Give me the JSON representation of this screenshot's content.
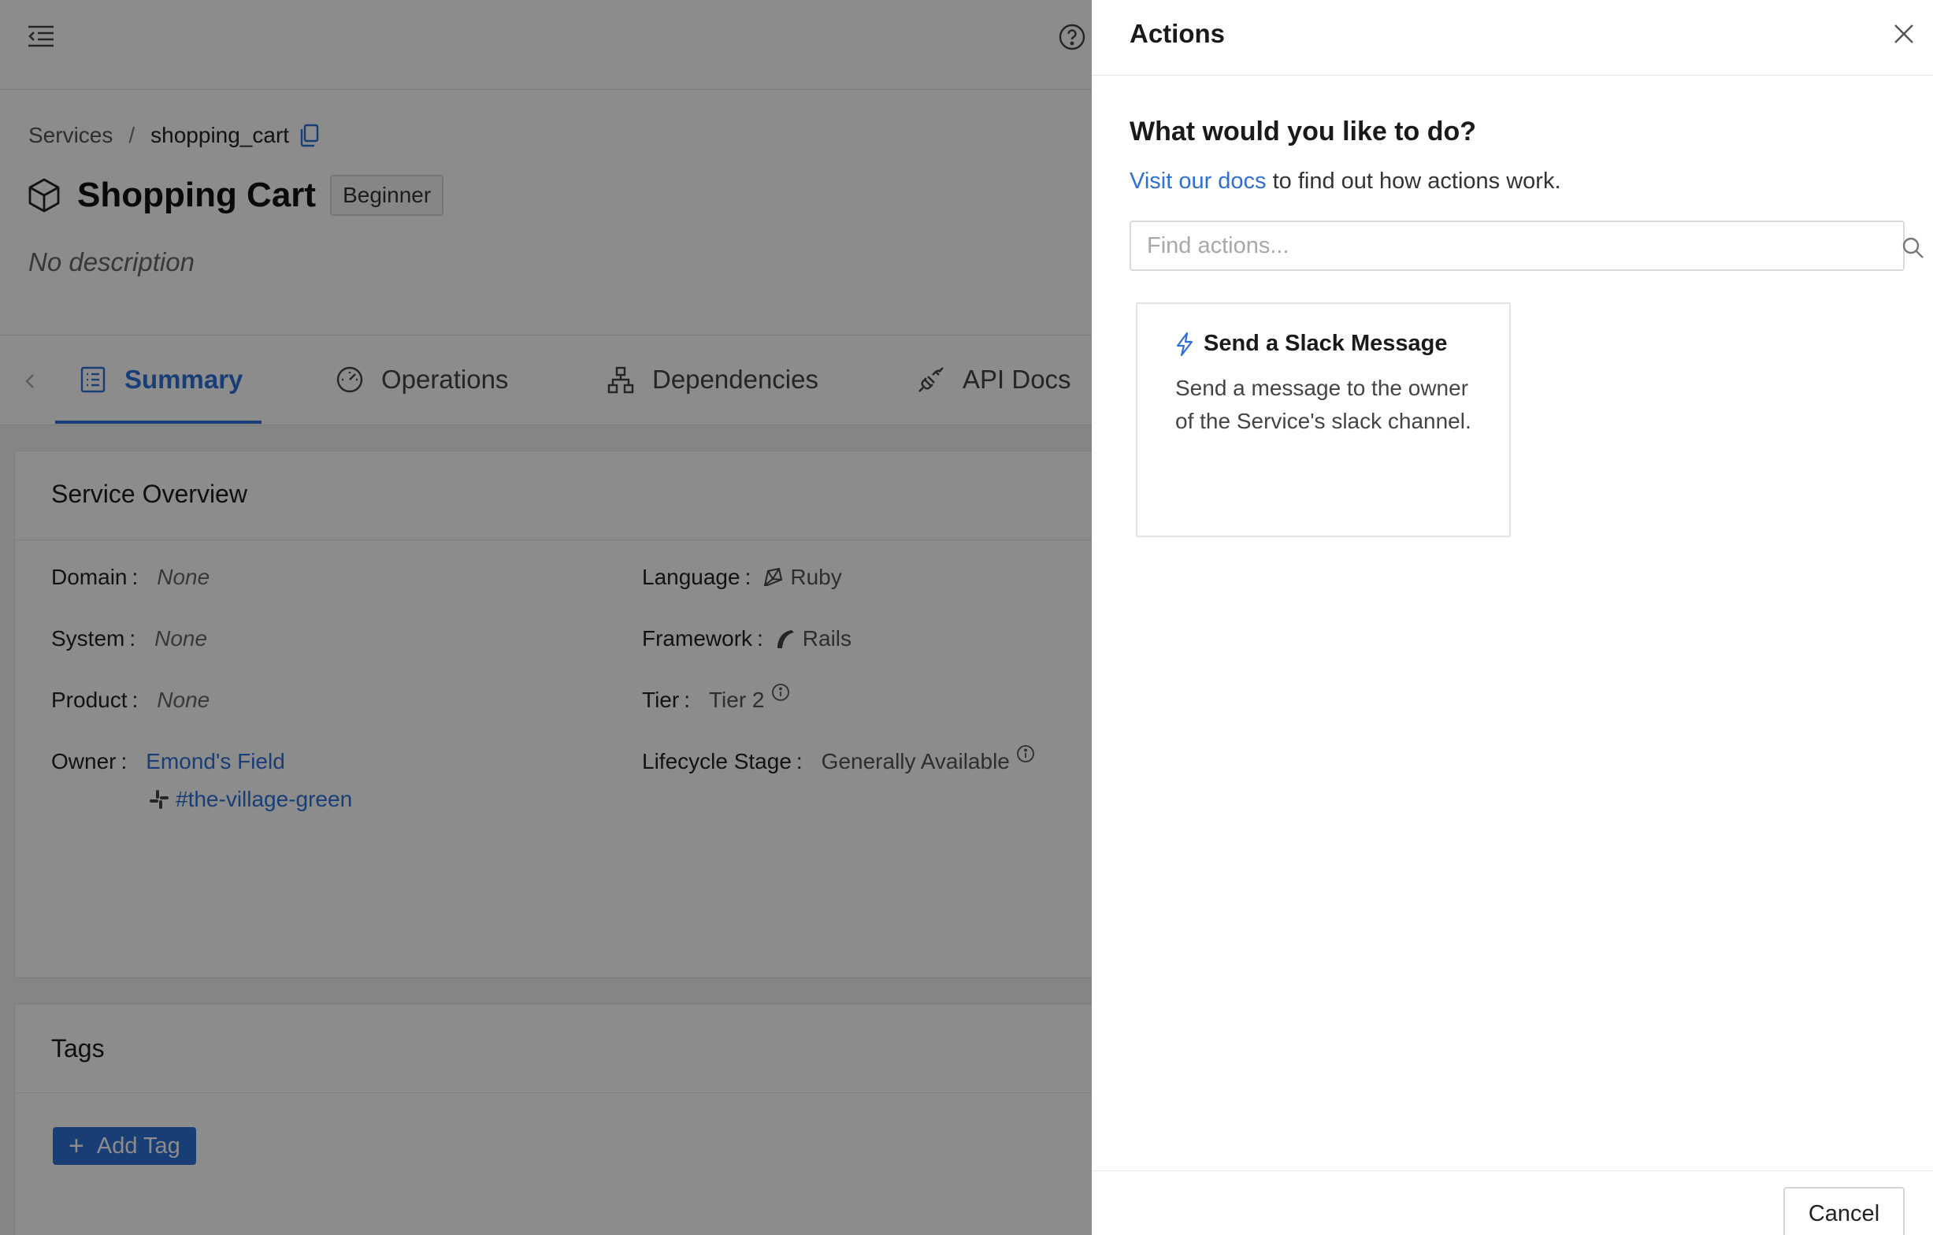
{
  "topbar": {
    "menu_icon": "menu-collapse-icon",
    "help_icon": "help-circle-icon"
  },
  "breadcrumb": {
    "parent": "Services",
    "separator": "/",
    "current": "shopping_cart"
  },
  "service": {
    "name": "Shopping Cart",
    "level": "Beginner",
    "description": "No description"
  },
  "tabs": [
    {
      "label": "Summary",
      "icon": "list-icon",
      "active": true
    },
    {
      "label": "Operations",
      "icon": "gauge-icon",
      "active": false
    },
    {
      "label": "Dependencies",
      "icon": "hierarchy-icon",
      "active": false
    },
    {
      "label": "API Docs",
      "icon": "plug-icon",
      "active": false
    }
  ],
  "overview": {
    "title": "Service Overview",
    "domain": {
      "label": "Domain",
      "value": "None"
    },
    "system": {
      "label": "System",
      "value": "None"
    },
    "product": {
      "label": "Product",
      "value": "None"
    },
    "owner": {
      "label": "Owner",
      "value": "Emond's Field",
      "slack_channel": "#the-village-green"
    },
    "language": {
      "label": "Language",
      "value": "Ruby"
    },
    "framework": {
      "label": "Framework",
      "value": "Rails"
    },
    "tier": {
      "label": "Tier",
      "value": "Tier 2"
    },
    "lifecycle": {
      "label": "Lifecycle Stage",
      "value": "Generally Available"
    }
  },
  "tags": {
    "title": "Tags",
    "add_label": "Add Tag"
  },
  "drawer": {
    "title": "Actions",
    "question": "What would you like to do?",
    "docs_link": "Visit our docs",
    "docs_suffix": " to find out how actions work.",
    "search_placeholder": "Find actions...",
    "actions": [
      {
        "title": "Send a Slack Message",
        "description": "Send a message to the owner of the Service's slack channel."
      }
    ],
    "cancel_label": "Cancel"
  },
  "colors": {
    "accent": "#2f6fd6",
    "overlay": "rgba(0,0,0,0.45)"
  }
}
